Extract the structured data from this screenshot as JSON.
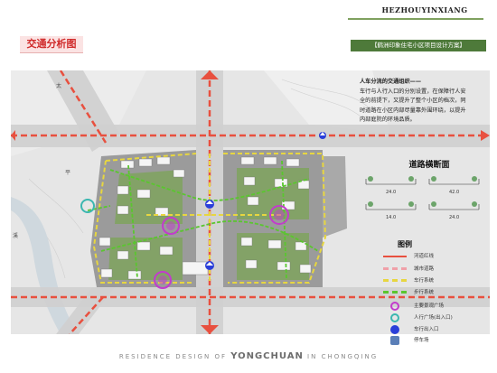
{
  "header": {
    "section_title": "交通分析图",
    "brand_title": "HEZHOUYINXIANG",
    "brand_subtitle": "【鹤洲印象住宅小区项目设计方案】"
  },
  "description": {
    "heading": "人车分流的交通组织——",
    "lines": [
      "车行与人行入口的分别设置，在保障行人安",
      "全的前提下，又提升了整个小区的档次，同",
      "时道路在小区内部尽量靠外围环绕，以提升",
      "内部庭院的环境品质。"
    ]
  },
  "map_labels": {
    "label_tai": "太",
    "label_ping": "平",
    "label_xi": "溪"
  },
  "road_sections": {
    "title": "道路横断面",
    "sections": [
      {
        "label": "24.0"
      },
      {
        "label": "42.0"
      },
      {
        "label": "14.0"
      },
      {
        "label": "24.0"
      }
    ]
  },
  "legend": {
    "title": "图例",
    "items": [
      {
        "label": "河道红线",
        "icon": "red-line"
      },
      {
        "label": "城市道路",
        "icon": "pink-dashed"
      },
      {
        "label": "车行系统",
        "icon": "yellow-dashed"
      },
      {
        "label": "步行系统",
        "icon": "green-dashed"
      },
      {
        "label": "主要景观广场",
        "icon": "magenta-plaza"
      },
      {
        "label": "人行广场(出入口)",
        "icon": "teal-circle"
      },
      {
        "label": "车行出入口",
        "icon": "blue-arrows"
      },
      {
        "label": "停车场",
        "icon": "parking-icon"
      }
    ]
  },
  "footer": {
    "left": "RESIDENCE DESIGN OF",
    "middle": "YONGCHUAN",
    "right": "IN CHONGQING"
  },
  "colors": {
    "city_road": "#e8503f",
    "vehicle": "#e7d640",
    "pedestrian": "#5ac62f",
    "plaza": "#c23ccc",
    "entrance": "#2a3fd9",
    "brand_green": "#4e7a3a"
  }
}
